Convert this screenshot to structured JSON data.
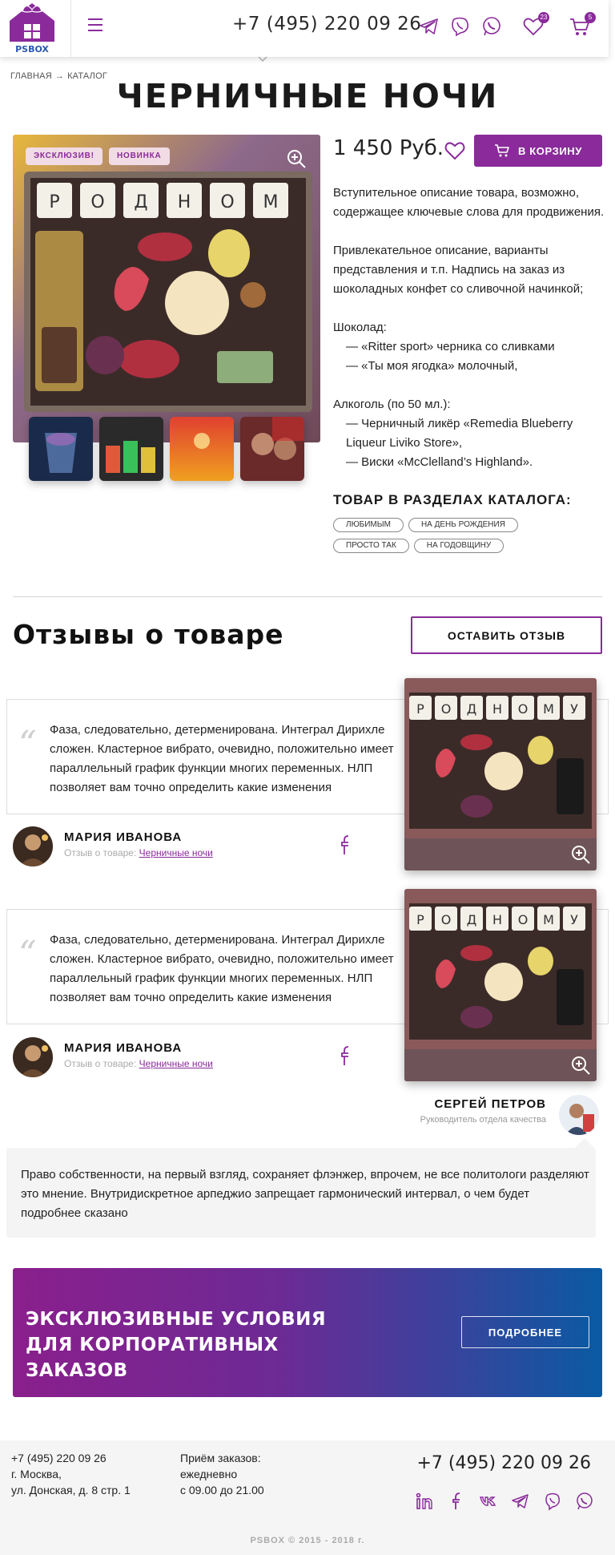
{
  "header": {
    "logo_text": "PSBOX",
    "phone": "+7 (495) 220 09 26",
    "favorites_count": "23",
    "cart_count": "5"
  },
  "breadcrumb": {
    "home": "ГЛАВНАЯ",
    "arrow": "→",
    "catalog": "КАТАЛОГ"
  },
  "product": {
    "title": "Черничные ночи",
    "tags": [
      "Эксклюзив!",
      "Новинка"
    ],
    "price": "1 450 Руб.",
    "cart_label": "В корзину",
    "description": {
      "intro": "Вступительное описание товара, возможно, содержащее ключевые слова для продвижения.",
      "appeal": "Привлекательное описание, варианты представления и т.п. Надпись на заказ из шоколадных конфет со сливочной начинкой;",
      "chocolate_title": "Шоколад:",
      "chocolate_1": "— «Ritter sport» черника со сливками",
      "chocolate_2": "— «Ты моя ягодка» молочный,",
      "alcohol_title": "Алкоголь (по 50 мл.):",
      "alcohol_1": "— Черничный ликёр «Remedia Blueberry Liqueur Liviko Store»,",
      "alcohol_2": "— Виски «McClelland’s Highland»."
    },
    "catalog_sections_title": "Товар в разделах каталога:",
    "catalog_sections": [
      "Любимым",
      "На день рождения",
      "Просто так",
      "На годовщину"
    ],
    "box_letters": [
      "Р",
      "О",
      "Д",
      "Н",
      "О",
      "М"
    ]
  },
  "reviews": {
    "title": "Отзывы о товаре",
    "leave_label": "Оставить отзыв",
    "items": [
      {
        "text": "Фаза, следовательно, детерменирована. Интеграл Дирихле сложен.  Кластерное вибрато, очевидно, положительно имеет параллельный график функции многих переменных. НЛП  позволяет вам точно определить какие изменения",
        "author": "Мария Иванова",
        "review_on_label": "Отзыв о товаре:",
        "product_link": "Черничные ночи"
      },
      {
        "text": "Фаза, следовательно, детерменирована. Интеграл Дирихле сложен.  Кластерное вибрато, очевидно, положительно имеет параллельный график функции многих переменных. НЛП  позволяет вам точно определить какие изменения",
        "author": "Мария Иванова",
        "review_on_label": "Отзыв о товаре:",
        "product_link": "Черничные ночи"
      }
    ],
    "review_box_letters": [
      "Р",
      "О",
      "Д",
      "Н",
      "О",
      "М",
      "У"
    ],
    "reply": {
      "name": "Сергей Петров",
      "role": "Руководитель отдела качества",
      "text": "Право собственности, на первый взгляд, сохраняет флэнжер, впрочем, не все политологи разделяют это мнение. Внутридискретное арпеджио запрещает гармонический интервал, о чем будет подробнее сказано"
    }
  },
  "banner": {
    "text": "Эксклюзивные условия для корпоративных заказов",
    "button": "Подробнее"
  },
  "footer": {
    "phone_small": "+7 (495) 220 09 26",
    "city": "г. Москва,",
    "address": "ул. Донская, д. 8 стр. 1",
    "orders_title": "Приём заказов:",
    "orders_days": "ежедневно",
    "orders_hours": "с 09.00 до 21.00",
    "phone_big": "+7 (495) 220 09 26",
    "copyright": "PSBOX © 2015 - 2018 г."
  },
  "colors": {
    "accent": "#8a2a9b",
    "banner_start": "#8a1f8c",
    "banner_end": "#0a5aa3"
  }
}
